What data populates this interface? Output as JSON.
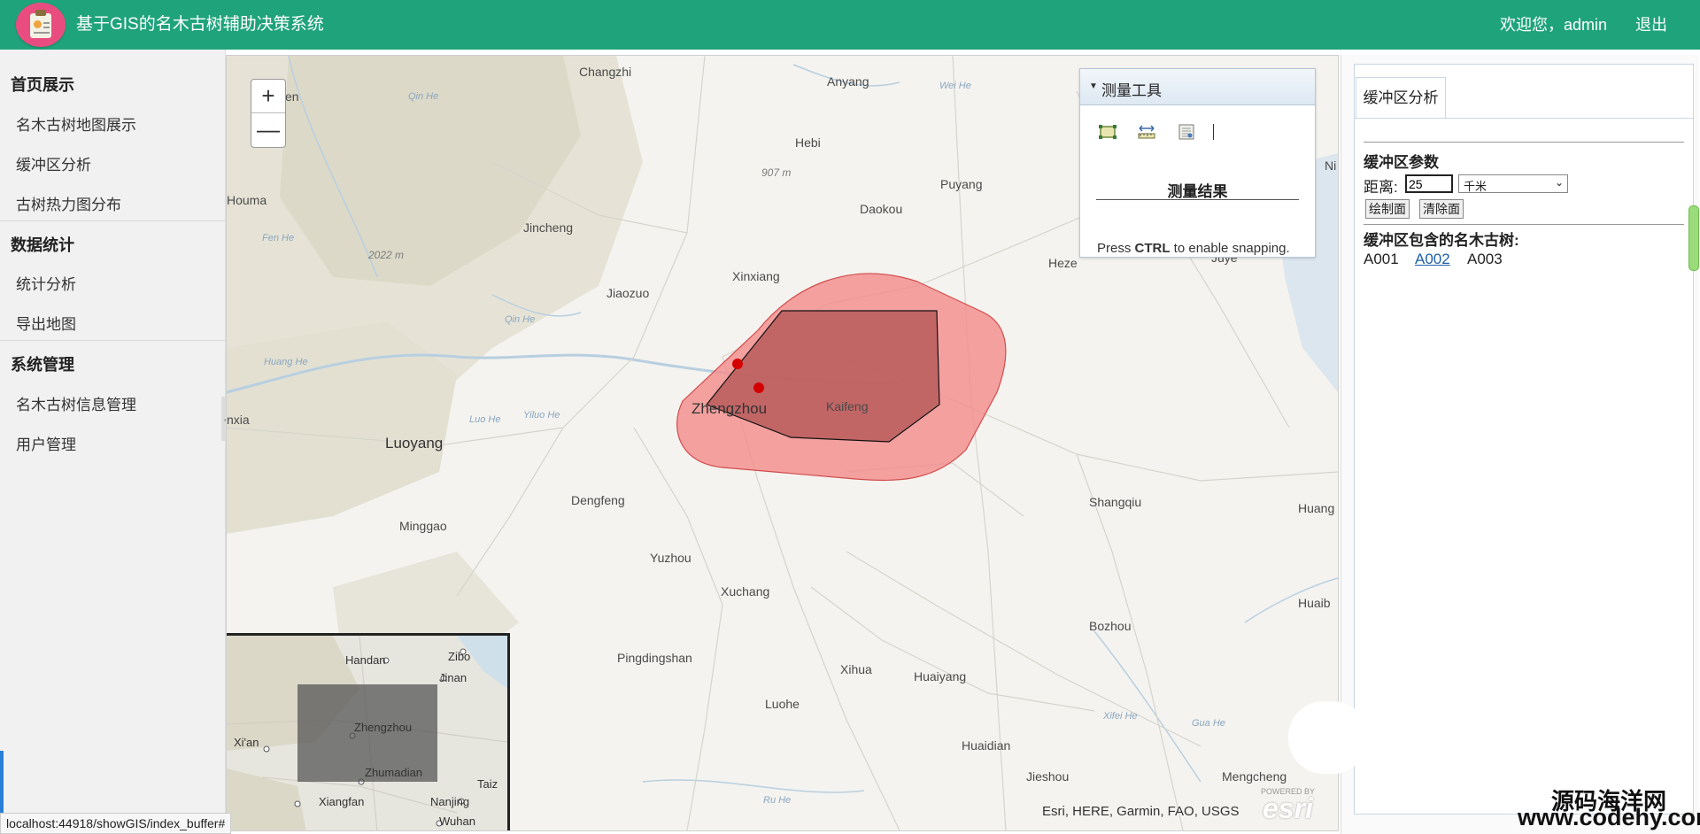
{
  "header": {
    "title": "基于GIS的名木古树辅助决策系统",
    "welcome": "欢迎您，admin",
    "logout": "退出"
  },
  "sidebar": {
    "sections": [
      {
        "title": "首页展示",
        "items": [
          "名木古树地图展示",
          "缓冲区分析",
          "古树热力图分布"
        ]
      },
      {
        "title": "数据统计",
        "items": [
          "统计分析",
          "导出地图"
        ]
      },
      {
        "title": "系统管理",
        "items": [
          "名木古树信息管理",
          "用户管理"
        ]
      }
    ]
  },
  "map": {
    "zoom_in": "+",
    "zoom_out": "—",
    "places": [
      "Changzhi",
      "Anyang",
      "Hebi",
      "Puyang",
      "Daokou",
      "Houma",
      "Jincheng",
      "Xinxiang",
      "Jiaozuo",
      "Heze",
      "Kaifeng",
      "Zhengzhou",
      "Luoyang",
      "Dengfeng",
      "Shangqiu",
      "Minggao",
      "Yuzhou",
      "Xuchang",
      "Bozhou",
      "Pingdingshan",
      "Xihua",
      "Huaiyang",
      "Luohe",
      "Huaidian",
      "Jieshou",
      "Mengcheng",
      "Huang",
      "Huaib",
      "Juye",
      "Ni",
      "en",
      "nxia"
    ],
    "water_labels": [
      "Wei He",
      "Qin He",
      "Luo He",
      "Yiluo He",
      "Huang He",
      "Qin He",
      "Gua He",
      "Xifei He",
      "Ru He",
      "Fen He"
    ],
    "elevations": [
      "907 m",
      "2022 m"
    ],
    "attribution": "Esri, HERE, Garmin, FAO, USGS",
    "esri_logo": "esri",
    "esri_powered": "POWERED BY",
    "buffer_fill": "#f28b8b",
    "polygon_fill": "#b85a5a",
    "point_color": "#d40000"
  },
  "measure_tool": {
    "title": "测量工具",
    "result_label": "测量结果",
    "snap_prefix": "Press ",
    "snap_key": "CTRL",
    "snap_suffix": " to enable snapping.",
    "tools": [
      "area-icon",
      "distance-icon",
      "location-icon"
    ]
  },
  "overview": {
    "places": [
      "Handan",
      "Zibo",
      "Jinan",
      "Zhengzhou",
      "Xi'an",
      "Zhumadian",
      "Xiangfan",
      "Nanjing",
      "Taiz",
      "Wuhan"
    ]
  },
  "buffer_panel": {
    "tab": "缓冲区分析",
    "params_title": "缓冲区参数",
    "distance_label": "距离:",
    "distance_value": "25",
    "unit": "千米",
    "draw_button": "绘制面",
    "clear_button": "清除面",
    "result_title": "缓冲区包含的名木古树:",
    "trees": [
      "A001",
      "A002",
      "A003"
    ]
  },
  "status_url": "localhost:44918/showGIS/index_buffer#",
  "watermark": {
    "line1": "源码海洋网",
    "line2": "www.codehy.com"
  }
}
